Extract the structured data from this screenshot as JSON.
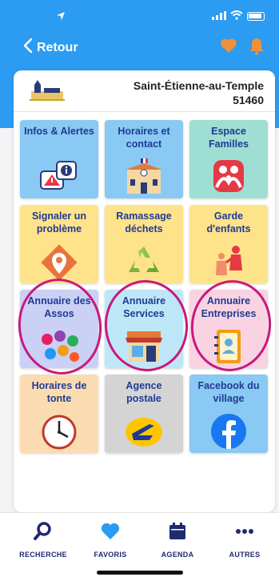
{
  "status_bar": {
    "time": "",
    "signal": "signal-icon",
    "wifi": "wifi-icon",
    "battery": "battery-icon"
  },
  "nav": {
    "back_label": "Retour"
  },
  "commune": {
    "name": "Saint-Étienne-au-Temple",
    "postcode": "51460",
    "logo_caption": "Saint-Étienne-au-Temple"
  },
  "tiles": [
    {
      "label": "Infos & Alertes",
      "icon": "info-alert-icon",
      "bg": "#89c9f3"
    },
    {
      "label": "Horaires et contact",
      "icon": "town-hall-icon",
      "bg": "#89c9f3"
    },
    {
      "label": "Espace Familles",
      "icon": "family-icon",
      "bg": "#9fded3"
    },
    {
      "label": "Signaler un problème",
      "icon": "report-pin-icon",
      "bg": "#ffe38a"
    },
    {
      "label": "Ramassage déchets",
      "icon": "recycle-icon",
      "bg": "#ffe38a"
    },
    {
      "label": "Garde d'enfants",
      "icon": "childcare-icon",
      "bg": "#ffe38a"
    },
    {
      "label": "Annuaire des Assos",
      "icon": "associations-icon",
      "bg": "#cbd0f5"
    },
    {
      "label": "Annuaire Services",
      "icon": "shop-icon",
      "bg": "#bde7f7"
    },
    {
      "label": "Annuaire Entreprises",
      "icon": "address-book-icon",
      "bg": "#f9d3e2"
    },
    {
      "label": "Horaires de tonte",
      "icon": "clock-icon",
      "bg": "#fbdcb2"
    },
    {
      "label": "Agence postale",
      "icon": "la-poste-icon",
      "bg": "#d4d4d4"
    },
    {
      "label": "Facebook du village",
      "icon": "facebook-icon",
      "bg": "#89c9f3"
    }
  ],
  "tabbar": [
    {
      "label": "RECHERCHE",
      "icon": "search-icon"
    },
    {
      "label": "FAVORIS",
      "icon": "heart-icon"
    },
    {
      "label": "AGENDA",
      "icon": "calendar-icon"
    },
    {
      "label": "AUTRES",
      "icon": "more-icon"
    }
  ],
  "colors": {
    "header_blue": "#2b9cf2",
    "accent_orange": "#f0913a",
    "label_navy": "#1f3a93",
    "highlight_magenta": "#c8197c"
  }
}
